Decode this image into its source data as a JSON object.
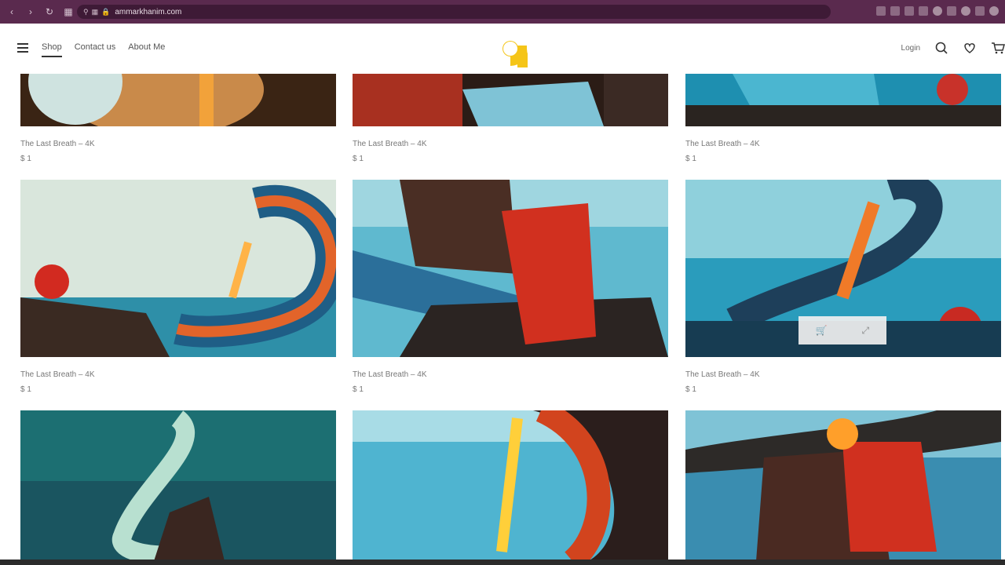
{
  "browser": {
    "url": "ammarkhanim.com",
    "back_icon": "arrow-left-icon",
    "forward_icon": "arrow-right-icon",
    "reload_icon": "reload-icon"
  },
  "header": {
    "nav": [
      {
        "label": "Shop",
        "active": true
      },
      {
        "label": "Contact us",
        "active": false
      },
      {
        "label": "About Me",
        "active": false
      }
    ],
    "login": "Login",
    "brand_color": "#F5C518"
  },
  "products": [
    {
      "title": "The Last Breath – 4K",
      "price": "$ 1"
    },
    {
      "title": "The Last Breath – 4K",
      "price": "$ 1"
    },
    {
      "title": "The Last Breath – 4K",
      "price": "$ 1"
    },
    {
      "title": "The Last Breath – 4K",
      "price": "$ 1"
    },
    {
      "title": "The Last Breath – 4K",
      "price": "$ 1"
    },
    {
      "title": "The Last Breath – 4K",
      "price": "$ 1"
    },
    {
      "title": "",
      "price": ""
    },
    {
      "title": "",
      "price": ""
    },
    {
      "title": "",
      "price": ""
    }
  ]
}
